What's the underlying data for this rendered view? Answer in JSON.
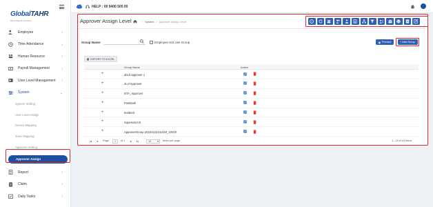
{
  "logo": {
    "brand_a": "Global",
    "brand_b": "TAHR",
    "tagline": "HR & Payroll Solutions"
  },
  "header": {
    "help_label": "HELP : 09 9400 505 00"
  },
  "sidebar": {
    "items": [
      {
        "label": "Employee",
        "icon": "users-icon"
      },
      {
        "label": "Time Attendance",
        "icon": "clock-icon"
      },
      {
        "label": "Human Resource",
        "icon": "people-icon"
      },
      {
        "label": "Payroll Management",
        "icon": "money-icon"
      },
      {
        "label": "User Level Management",
        "icon": "user-level-icon"
      },
      {
        "label": "System",
        "icon": "sliders-icon"
      }
    ],
    "system_sub": [
      "System Setting",
      "User Level Assign",
      "Device Mapping",
      "Zone Mapping",
      "Approver Setting"
    ],
    "active_label": "Approver Assign",
    "after": [
      {
        "label": "Report",
        "icon": "report-icon"
      },
      {
        "label": "Claim",
        "icon": "claim-icon"
      },
      {
        "label": "Daily Tasks",
        "icon": "tasks-icon"
      }
    ]
  },
  "page": {
    "title": "Approver Assign Level",
    "breadcrumb_system": "System",
    "breadcrumb_current": "Approver Assign Level"
  },
  "filters": {
    "group_name_label": "Group Name:",
    "group_name_value": "",
    "checkbox_label": "Employee Not Use Group",
    "preview_label": "Preview",
    "add_group_label": "+ Add Group"
  },
  "export_label": "EXPORT TO EXCEL",
  "grid": {
    "col_group": "Group Name",
    "col_action": "Action",
    "rows": [
      "abcd approver 1",
      "2Lvl Approver",
      "NTA_Approver",
      "PostDark",
      "testbreit",
      "Supervisor B",
      "ApproverGroup 20221122141420_10010"
    ]
  },
  "pager": {
    "page_label": "Page",
    "page_value": "1",
    "of_label": "of 1",
    "size_value": "15",
    "size_label": "items per page",
    "summary": "1 - 15 of 41 items"
  },
  "colors": {
    "primary": "#2f5fb3",
    "active": "#1e50a0",
    "highlight": "#e0252b",
    "delete": "#e03b3b"
  }
}
